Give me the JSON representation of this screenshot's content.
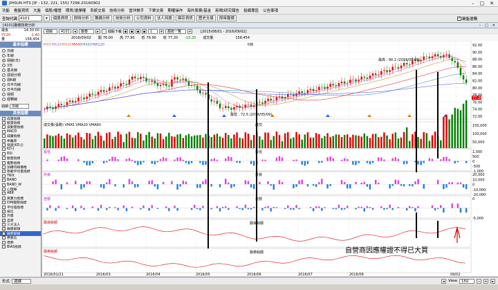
{
  "window": {
    "title": "JIHSUN HTS    [IP : 132, 221, 155] 7298.20160902"
  },
  "menu": [
    "功能",
    "看盤資訊",
    "大盤",
    "個股/權證",
    "期貨/選擇權",
    "系統交易",
    "技術分析",
    "當沖推手",
    "下單交易",
    "期權操作",
    "海外股票/基金",
    "新聞/研究報告",
    "投顧專區",
    "公告事項"
  ],
  "toolbar": {
    "code_label": "查詢代碼",
    "code_value": "4101",
    "buttons": [
      "個股資訊",
      "即時分析",
      "籌碼分析",
      "技術分析",
      "公司資料",
      "法人持股",
      "庫存資訊",
      "歷史交易",
      "即時報價"
    ],
    "checkbox_label": "鍵盤選購"
  },
  "subtitle": "[4101]聯泰技術分析",
  "row1": {
    "period": "週線",
    "stock": "4101",
    "name": "聯泰",
    "check_label": "個股下載",
    "count": "1",
    "option": "趨勢一覽",
    "range": "[2015/08/01 - 2016/09/02]"
  },
  "row2": {
    "time": "14:30:00",
    "date": "2016/09/02",
    "open_label": "開",
    "open": "76.00",
    "high_label": "高",
    "high": "77.90",
    "low_label": "低",
    "low": "76.90",
    "close_label": "收",
    "close": "77.20",
    "chg": "-10.20",
    "vol_label": "成交量",
    "vol": "158,454",
    "price": "77.20",
    "price_chg": "-1.40"
  },
  "left": {
    "top": [
      {
        "k": "最後",
        "v": "14:30:00"
      },
      {
        "k": "YY.20",
        "v": "-1.40"
      },
      {
        "k": "量",
        "v": "158,454"
      }
    ],
    "section1": "基本指標",
    "radios": [
      "當日線",
      "年線",
      "K線",
      "3日",
      "13日",
      "週頻",
      "月頻",
      "本年",
      "月",
      "今年"
    ],
    "radio_list": [
      "日線",
      "年線",
      "週線(日)",
      "3日",
      "基本線",
      "週週分頻",
      "週K線",
      "日平均線",
      "日平均線",
      "週頻",
      "經轉線",
      "折線"
    ],
    "select_label": "週期",
    "select_value": "日線",
    "section2": "其他指標",
    "indicators": [
      {
        "label": "成量指標",
        "checked": false
      },
      {
        "label": "股量指標",
        "checked": false
      },
      {
        "label": "波動量指標",
        "checked": false
      },
      {
        "label": "MACD",
        "checked": false
      },
      {
        "label": "威廉指標",
        "checked": false
      },
      {
        "label": "乖離率",
        "checked": false
      },
      {
        "label": "快速(KD-J)",
        "checked": false
      },
      {
        "label": "KD-J",
        "checked": false
      },
      {
        "label": "RSI",
        "checked": false
      },
      {
        "label": "動量指標",
        "checked": false
      },
      {
        "label": "趨勢指標",
        "checked": false
      },
      {
        "label": "加權均線價格",
        "checked": false
      },
      {
        "label": "移動平均量指標",
        "checked": false
      },
      {
        "label": "TRIX",
        "checked": false
      },
      {
        "label": "BAND",
        "checked": false
      },
      {
        "label": "BAND_W",
        "checked": false
      },
      {
        "label": "心理線",
        "checked": false
      },
      {
        "label": "ABR",
        "checked": false
      },
      {
        "label": "買賣力指標",
        "checked": false
      },
      {
        "label": "DMI趨勢指標",
        "checked": false
      },
      {
        "label": "平均值指標",
        "checked": false
      },
      {
        "label": "投信",
        "checked": true
      },
      {
        "label": "外資",
        "checked": true
      },
      {
        "label": "自營",
        "checked": true
      },
      {
        "label": "三大法人",
        "checked": false
      },
      {
        "label": "融資餘額",
        "checked": true
      },
      {
        "label": "融券餘額",
        "checked": true
      },
      {
        "label": "券資比",
        "checked": false
      },
      {
        "label": "借券",
        "checked": false
      },
      {
        "label": "BIAS指標",
        "checked": false
      }
    ]
  },
  "chart": {
    "ma_legend": [
      {
        "t": "MA5",
        "c": "#e06060"
      },
      {
        "t": "MA10",
        "c": "#d040d0"
      },
      {
        "t": "MA20",
        "c": "#c08000"
      },
      {
        "t": "MA40",
        "c": "#e00000"
      },
      {
        "t": "MA60",
        "c": "#2080c0"
      },
      {
        "t": "MA120",
        "c": "#4040ff"
      }
    ],
    "k_title": "K線",
    "high_note": "最高 : 90.1 (2016/08/09)",
    "low_note": "最低 : 72.5 (2016/05/09)",
    "price_ticks": [
      "92.00",
      "90.00",
      "88.00",
      "86.00",
      "84.00",
      "82.00",
      "80.00",
      "78.00",
      "76.00",
      "74.00",
      "72.00"
    ],
    "cur_price": "77.20",
    "vol_legend": "成交量(張數) VMA5 VMA20 VMA60",
    "vol_title": "成交",
    "vol_ticks": [
      "150,000",
      "100,000",
      "50,000"
    ],
    "p3_label": "投信",
    "p3_title": "投信",
    "p3_ticks": [
      "1,000",
      "500",
      "0",
      "-500",
      "-1,000"
    ],
    "p4_label": "外資",
    "p4_title": "外資",
    "p4_ticks": [
      "20,000",
      "10,000",
      "0",
      "-10,000",
      "-20,000"
    ],
    "p5_label": "自營",
    "p5_title": "自營",
    "p5_ticks": [
      "0",
      "-5,000"
    ],
    "p6_label": "融資餘額",
    "p6_title": "融資餘額",
    "p7_label": "融券餘額",
    "p7_title": "融券餘額",
    "annotation": "自營商因應權證不得已大買",
    "x_labels": [
      "2016/01/21",
      "2016/03",
      "2016/04",
      "2016/05",
      "2016/06",
      "2016/07",
      "2016/08",
      "09/02"
    ]
  },
  "bottom": {
    "label": "形式",
    "select": "週線",
    "view_label": "View",
    "view_value": "150"
  }
}
